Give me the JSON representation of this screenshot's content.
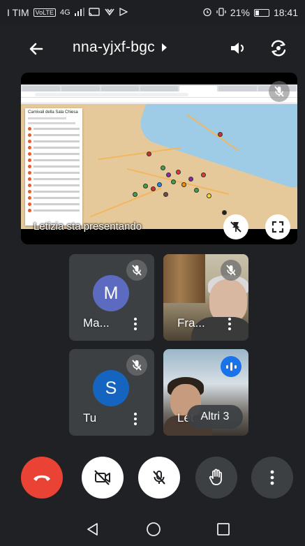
{
  "status_bar": {
    "carrier": "I TIM",
    "volte": "VoLTE",
    "network": "4G",
    "battery_percent": "21%",
    "time": "18:41"
  },
  "header": {
    "meeting_code": "nna-yjxf-bgc"
  },
  "presentation": {
    "caption": "Letizia sta presentando",
    "map_panel_title": "Carnivali della Sala Chiesa"
  },
  "participants": [
    {
      "initial": "M",
      "name": "Ma...",
      "avatar_color": "#5c6bc0"
    },
    {
      "name": "Fra..."
    },
    {
      "initial": "S",
      "name": "Tu",
      "avatar_color": "#1565c0"
    },
    {
      "name": "Let"
    }
  ],
  "more_participants": "Altri 3",
  "colors": {
    "background": "#202124",
    "tile": "#3c4043",
    "hangup": "#ea4335",
    "speaking": "#1a73e8"
  }
}
